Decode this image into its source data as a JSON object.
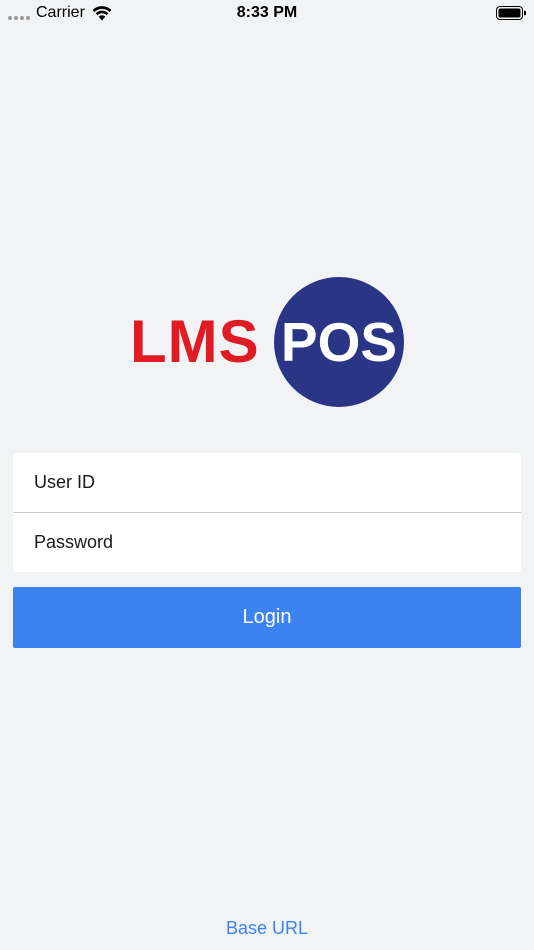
{
  "status_bar": {
    "carrier": "Carrier",
    "time": "8:33 PM",
    "icons": [
      "signal-dots-icon",
      "wifi-icon",
      "battery-icon"
    ]
  },
  "logo": {
    "left_text": "LMS",
    "right_text": "POS",
    "colors": {
      "red": "#e01b24",
      "navy": "#2b3585"
    }
  },
  "form": {
    "user_id_placeholder": "User ID",
    "password_placeholder": "Password"
  },
  "login_label": "Login",
  "base_url_label": "Base URL",
  "colors": {
    "accent": "#3c82f0",
    "background": "#f2f3f5"
  }
}
